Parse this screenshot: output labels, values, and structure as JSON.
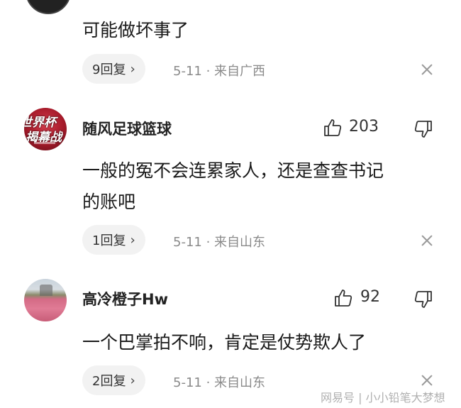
{
  "comments": [
    {
      "content": "可能做坏事了",
      "reply_label": "9回复",
      "meta": "5-11 · 来自广西"
    },
    {
      "username": "随风足球篮球",
      "avatar_text_1": "世界杯",
      "avatar_text_2": "揭幕战",
      "likes": "203",
      "content_line1": "一般的冤不会连累家人，还是查查书记",
      "content_line2": "的账吧",
      "reply_label": "1回复",
      "meta": "5-11 · 来自山东"
    },
    {
      "username": "高冷橙子Hw",
      "likes": "92",
      "content": "一个巴掌拍不响，肯定是仗势欺人了",
      "reply_label": "2回复",
      "meta": "5-11 · 来自山东"
    }
  ],
  "watermark": "网易号 | 小小铅笔大梦想",
  "icons": [
    "thumbs-up-icon",
    "thumbs-down-icon",
    "close-icon",
    "chevron-right-icon"
  ]
}
